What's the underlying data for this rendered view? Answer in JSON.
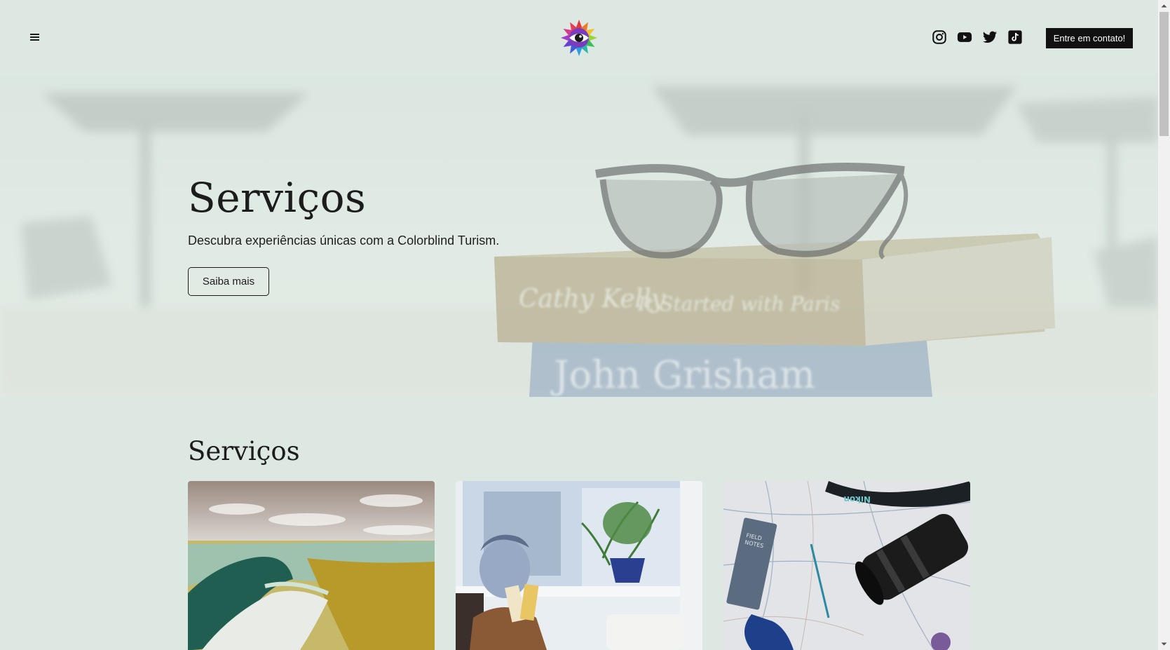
{
  "header": {
    "menu_icon": "hamburger-menu-icon",
    "logo_icon": "rainbow-eye-logo",
    "socials": [
      "instagram-icon",
      "youtube-icon",
      "twitter-icon",
      "tiktok-icon"
    ],
    "contact_label": "Entre em contato!"
  },
  "hero": {
    "title": "Serviços",
    "subtitle": "Descubra experiências únicas com a Colorblind Turism.",
    "button_label": "Saiba mais",
    "book_text_1": "Cathy Kelly",
    "book_text_2": "It Started with Paris",
    "book_text_3": "John Grisham"
  },
  "services": {
    "title": "Serviços",
    "cards": [
      {
        "image": "aerial-beach-photo"
      },
      {
        "image": "man-holding-tickets-photo"
      },
      {
        "image": "map-camera-notebook-photo",
        "notebook_text_1": "FIELD",
        "notebook_text_2": "NOTES",
        "strap_text": "Nikon"
      }
    ]
  },
  "colors": {
    "background": "#dde8e3",
    "button_dark": "#111111",
    "text": "#1c1c1c"
  }
}
